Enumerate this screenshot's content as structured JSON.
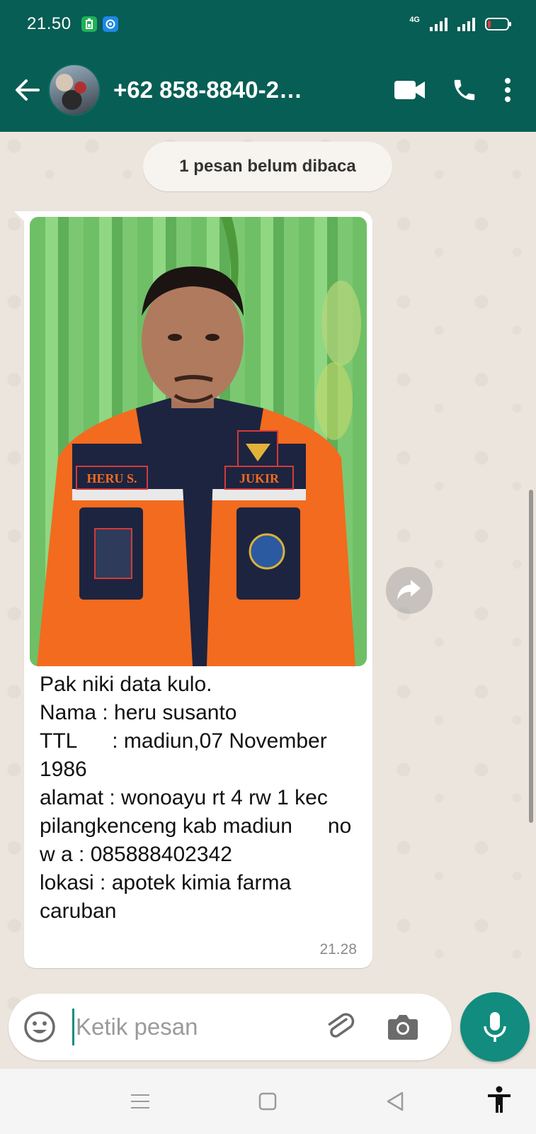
{
  "status_bar": {
    "time": "21.50",
    "network": "4G",
    "battery_level": 0.15,
    "battery_color": "#e53935"
  },
  "app_bar": {
    "contact_name": "+62 858-8840-2…",
    "icons": [
      "back-arrow-icon",
      "video-call-icon",
      "phone-icon",
      "more-vert-icon"
    ],
    "color": "#075e54"
  },
  "chat": {
    "unread_notice": "1 pesan belum dibaca",
    "message": {
      "caption": "Pak niki data kulo.\nNama : heru susanto\nTTL      : madiun,07 November 1986\nalamat : wonoayu rt 4 rw 1 kec pilangkenceng kab madiun      no w a : 085888402342\nlokasi : apotek kimia farma caruban",
      "time": "21.28",
      "photo_labels": {
        "name_patch": "HERU S.",
        "role_patch": "JUKIR"
      }
    }
  },
  "input": {
    "placeholder": "Ketik pesan",
    "value": ""
  },
  "colors": {
    "accent": "#128c7e",
    "header": "#075e54",
    "chat_bg": "#ece5dd"
  }
}
